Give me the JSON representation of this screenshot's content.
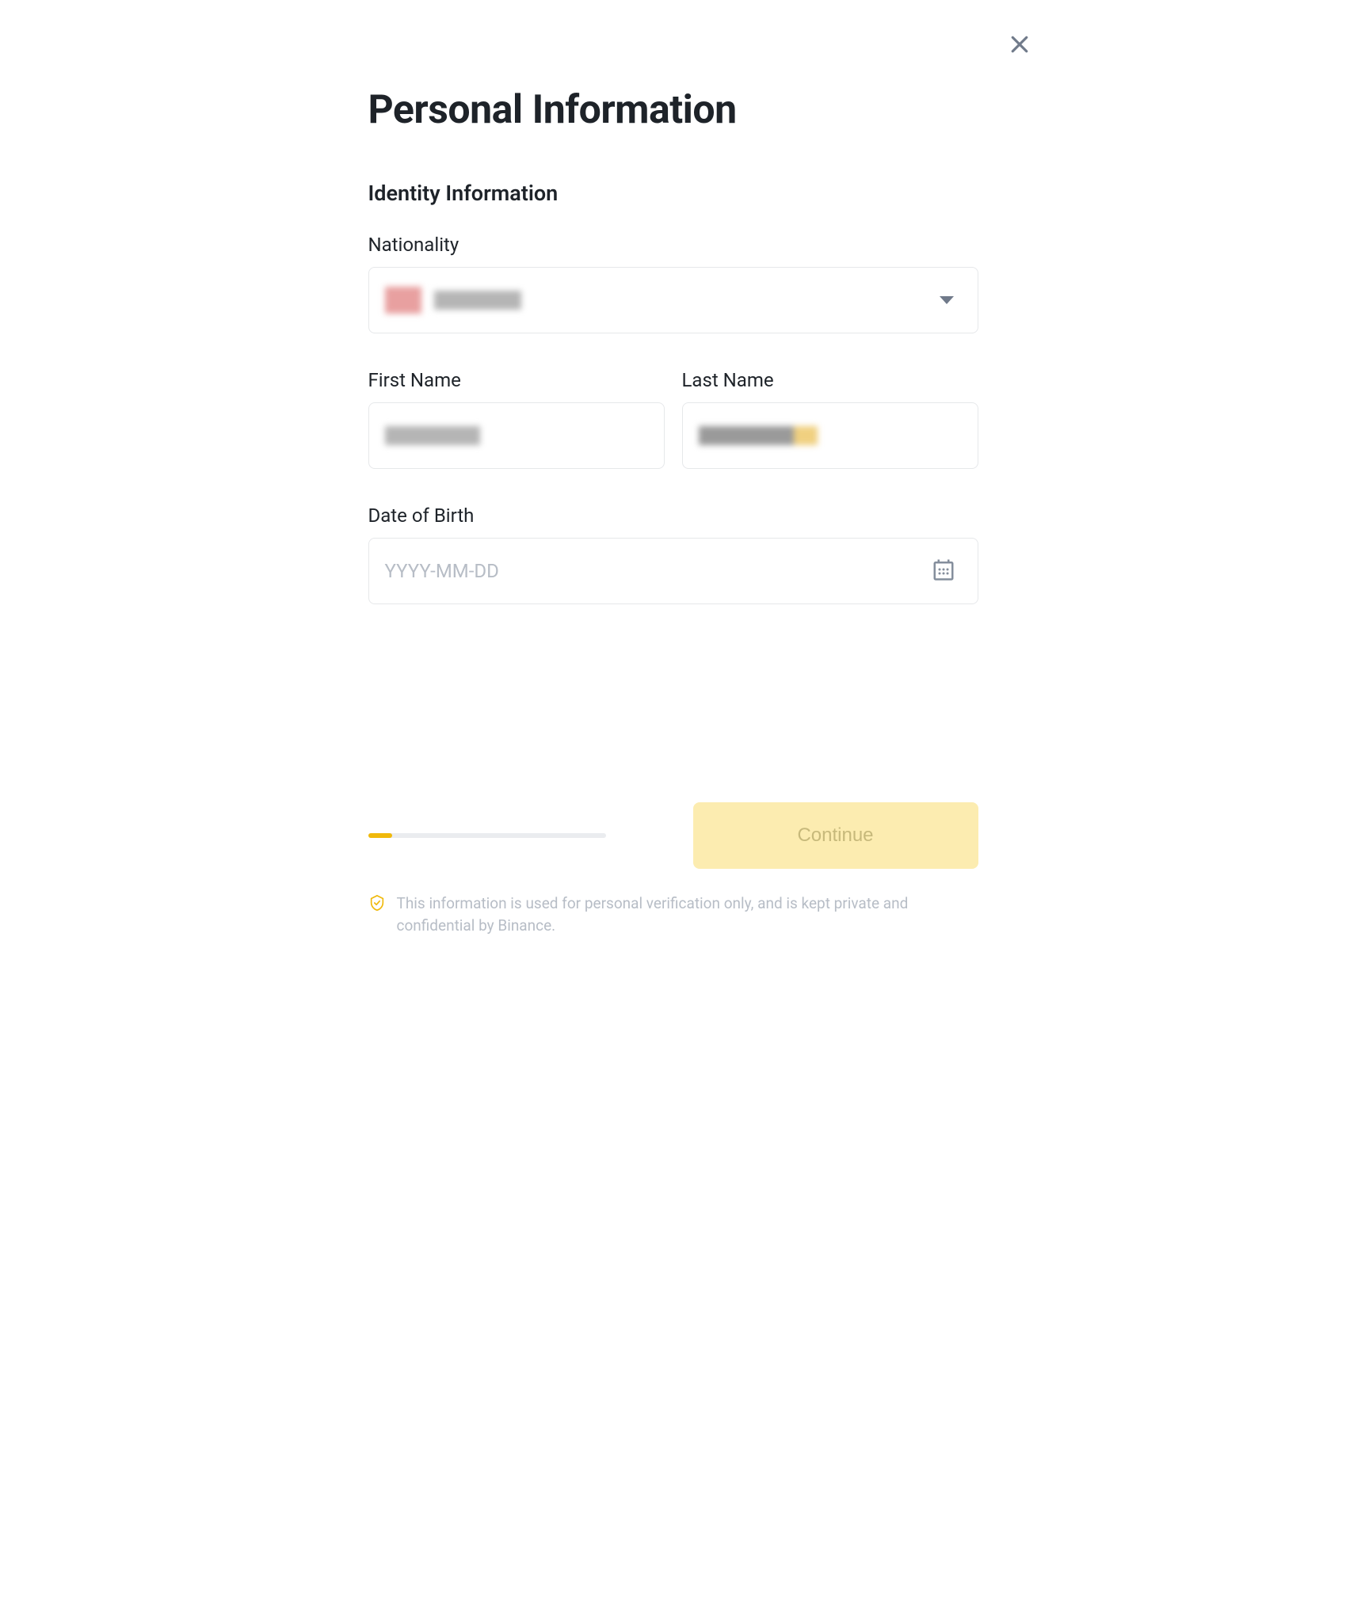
{
  "modal": {
    "title": "Personal Information",
    "section_title": "Identity Information"
  },
  "fields": {
    "nationality": {
      "label": "Nationality",
      "value_redacted": true
    },
    "first_name": {
      "label": "First Name",
      "value_redacted": true
    },
    "last_name": {
      "label": "Last Name",
      "value_redacted": true
    },
    "dob": {
      "label": "Date of Birth",
      "placeholder": "YYYY-MM-DD",
      "value": ""
    }
  },
  "footer": {
    "continue_label": "Continue",
    "progress_percent": 10,
    "disclaimer": "This information is used for personal verification only, and is kept private and confidential by Binance."
  }
}
